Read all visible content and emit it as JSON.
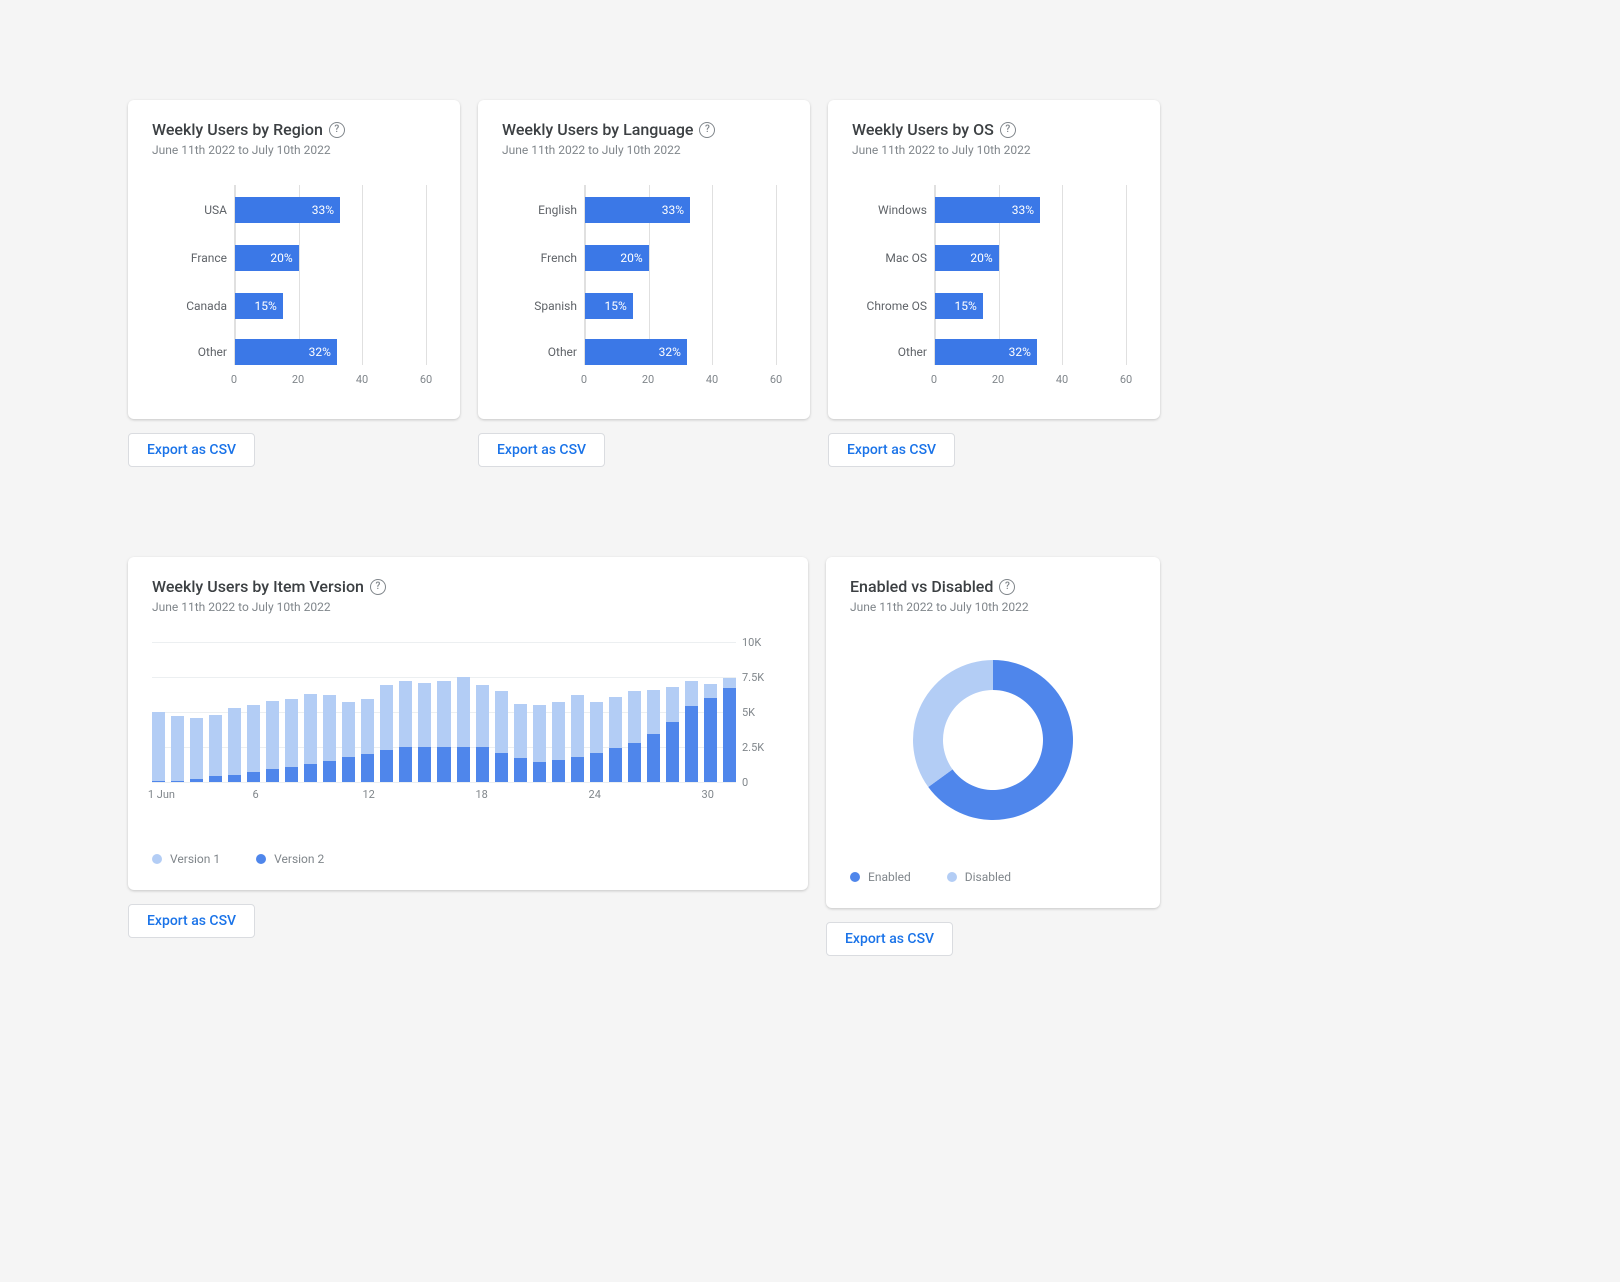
{
  "date_range": "June 11th 2022 to July 10th 2022",
  "export_label": "Export as CSV",
  "cards": {
    "region": {
      "title": "Weekly Users by Region"
    },
    "language": {
      "title": "Weekly Users by Language"
    },
    "os": {
      "title": "Weekly Users by OS"
    },
    "version": {
      "title": "Weekly Users by Item Version",
      "legend": {
        "v1": "Version 1",
        "v2": "Version 2"
      }
    },
    "enabled": {
      "title": "Enabled vs Disabled",
      "legend": {
        "enabled": "Enabled",
        "disabled": "Disabled"
      }
    }
  },
  "chart_data": [
    {
      "id": "region",
      "type": "bar",
      "orientation": "horizontal",
      "categories": [
        "USA",
        "France",
        "Canada",
        "Other"
      ],
      "values": [
        33,
        20,
        15,
        32
      ],
      "value_suffix": "%",
      "xlim": [
        0,
        60
      ],
      "xticks": [
        0,
        20,
        40,
        60
      ]
    },
    {
      "id": "language",
      "type": "bar",
      "orientation": "horizontal",
      "categories": [
        "English",
        "French",
        "Spanish",
        "Other"
      ],
      "values": [
        33,
        20,
        15,
        32
      ],
      "value_suffix": "%",
      "xlim": [
        0,
        60
      ],
      "xticks": [
        0,
        20,
        40,
        60
      ]
    },
    {
      "id": "os",
      "type": "bar",
      "orientation": "horizontal",
      "categories": [
        "Windows",
        "Mac OS",
        "Chrome OS",
        "Other"
      ],
      "values": [
        33,
        20,
        15,
        32
      ],
      "value_suffix": "%",
      "xlim": [
        0,
        60
      ],
      "xticks": [
        0,
        20,
        40,
        60
      ]
    },
    {
      "id": "version",
      "type": "bar",
      "orientation": "vertical",
      "stacked": true,
      "x": [
        1,
        2,
        3,
        4,
        5,
        6,
        7,
        8,
        9,
        10,
        11,
        12,
        13,
        14,
        15,
        16,
        17,
        18,
        19,
        20,
        21,
        22,
        23,
        24,
        25,
        26,
        27,
        28,
        29,
        30,
        31
      ],
      "x_label_prefix_first": "1 Jun",
      "x_ticks_shown": [
        1,
        6,
        12,
        18,
        24,
        30
      ],
      "series": [
        {
          "name": "Version 1",
          "color": "#b3cdf5",
          "values": [
            4900,
            4600,
            4400,
            4400,
            4800,
            4800,
            4900,
            4800,
            5000,
            4700,
            3900,
            3900,
            4600,
            4700,
            4600,
            4700,
            5000,
            4400,
            4400,
            3900,
            4100,
            4100,
            4400,
            3600,
            3700,
            3700,
            3200,
            2500,
            1800,
            1000,
            700
          ]
        },
        {
          "name": "Version 2",
          "color": "#4f86eb",
          "values": [
            100,
            100,
            200,
            400,
            500,
            700,
            900,
            1100,
            1300,
            1500,
            1800,
            2000,
            2300,
            2500,
            2500,
            2500,
            2500,
            2500,
            2100,
            1700,
            1400,
            1600,
            1800,
            2100,
            2400,
            2800,
            3400,
            4300,
            5400,
            6000,
            6700
          ]
        }
      ],
      "ylim": [
        0,
        10000
      ],
      "yticks": [
        0,
        2500,
        5000,
        7500,
        10000
      ],
      "ytick_labels": [
        "0",
        "2.5K",
        "5K",
        "7.5K",
        "10K"
      ]
    },
    {
      "id": "enabled",
      "type": "pie",
      "donut": true,
      "categories": [
        "Enabled",
        "Disabled"
      ],
      "values": [
        65,
        35
      ],
      "colors": [
        "#4f86eb",
        "#b3cdf5"
      ]
    }
  ]
}
